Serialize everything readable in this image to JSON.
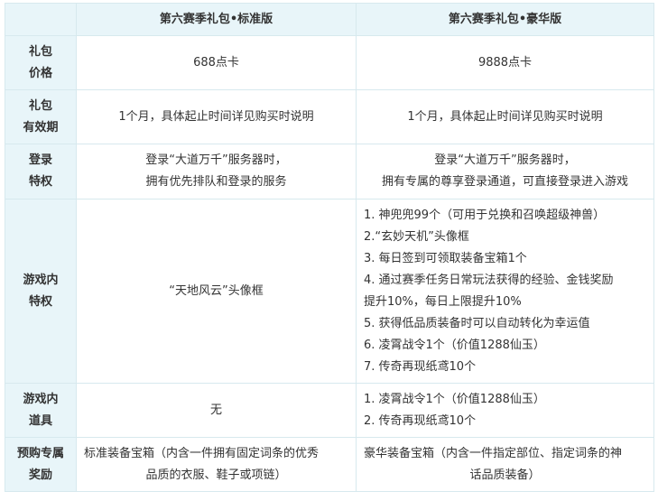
{
  "table": {
    "corner": "",
    "columns": [
      "第六赛季礼包•标准版",
      "第六赛季礼包•豪华版"
    ],
    "rows": [
      {
        "label": [
          "礼包",
          "价格"
        ],
        "standard": [
          "688点卡"
        ],
        "deluxe": [
          "9888点卡"
        ]
      },
      {
        "label": [
          "礼包",
          "有效期"
        ],
        "standard": [
          "1个月，具体起止时间详见购买时说明"
        ],
        "deluxe": [
          "1个月，具体起止时间详见购买时说明"
        ]
      },
      {
        "label": [
          "登录",
          "特权"
        ],
        "standard": [
          "登录“大道万千”服务器时，",
          "拥有优先排队和登录的服务"
        ],
        "deluxe": [
          "登录“大道万千”服务器时，",
          "拥有专属的尊享登录通道，可直接登录进入游戏"
        ]
      },
      {
        "label": [
          "游戏内",
          "特权"
        ],
        "standard": [
          "“天地风云”头像框"
        ],
        "deluxe": [
          "1. 神兜兜99个（可用于兑换和召唤超级神兽）",
          "2.“玄妙天机”头像框",
          "3. 每日签到可领取装备宝箱1个",
          "4. 通过赛季任务日常玩法获得的经验、金钱奖励",
          "提升10%，每日上限提升10%",
          "5. 获得低品质装备时可以自动转化为幸运值",
          "6. 凌霄战令1个（价值1288仙玉）",
          "7. 传奇再现纸鸢10个"
        ]
      },
      {
        "label": [
          "游戏内",
          "道具"
        ],
        "standard": [
          "无"
        ],
        "deluxe": [
          "1. 凌霄战令1个（价值1288仙玉）",
          "2. 传奇再现纸鸢10个"
        ]
      },
      {
        "label": [
          "预购专属",
          "奖励"
        ],
        "standard": [
          "标准装备宝箱（内含一件拥有固定词条的优秀",
          "品质的衣服、鞋子或项链）"
        ],
        "deluxe": [
          "豪华装备宝箱（内含一件指定部位、指定词条的神",
          "话品质装备）"
        ]
      }
    ]
  }
}
